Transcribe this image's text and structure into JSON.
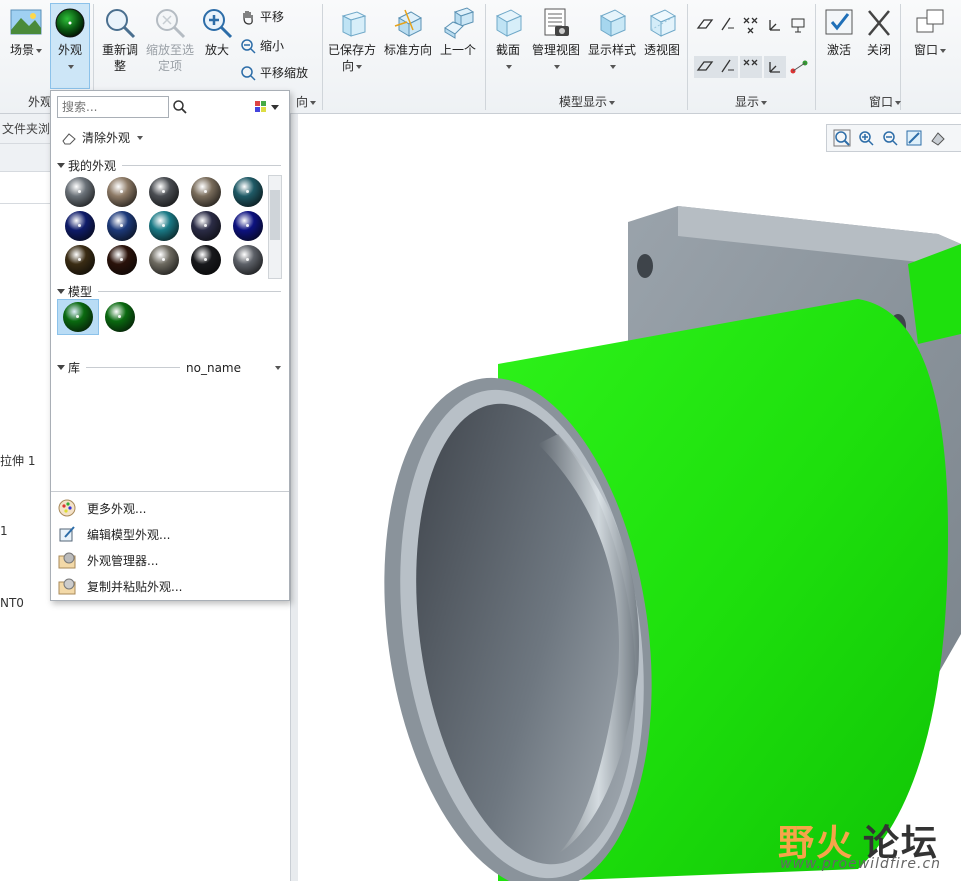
{
  "ribbon": {
    "groups": {
      "appearance": "外观",
      "orientation": "向",
      "model_display": "模型显示",
      "display": "显示",
      "window": "窗口"
    },
    "buttons": {
      "scene": "场景",
      "appearance": "外观",
      "regenerate_line1": "重新调",
      "regenerate_line2": "整",
      "zoom_to_selected_line1": "缩放至选",
      "zoom_to_selected_line2": "定项",
      "zoom_in": "放大",
      "pan": "平移",
      "zoom_out": "缩小",
      "pan_zoom": "平移缩放",
      "saved_orient_line1": "已保存方",
      "saved_orient_line2": "向",
      "standard_orient": "标准方向",
      "previous": "上一个",
      "section": "截面",
      "manage_views": "管理视图",
      "display_style": "显示样式",
      "perspective": "透视图",
      "activate": "激活",
      "close": "关闭",
      "window": "窗口"
    }
  },
  "left_panel": {
    "header": "文件夹浏览",
    "tree_items": [
      "拉伸 1",
      "1",
      "NT0"
    ]
  },
  "appearance_panel": {
    "search_placeholder": "搜索...",
    "clear_label": "清除外观",
    "my_appearances_title": "我的外观",
    "model_title": "模型",
    "library_title": "库",
    "library_value": "no_name",
    "swatch_colors": [
      "#6a7178",
      "#8d7a66",
      "#4a4d52",
      "#7a6d5c",
      "#1f5a66",
      "#0f1c6a",
      "#1d3a7a",
      "#1a7a86",
      "#2b2c46",
      "#0d1280",
      "#3a2c14",
      "#2a120a",
      "#6d6a60",
      "#18191c",
      "#5d6168"
    ],
    "model_swatches": [
      "#0a6a10",
      "#0a6a10"
    ],
    "menu": [
      "更多外观...",
      "编辑模型外观...",
      "外观管理器...",
      "复制并粘贴外观..."
    ]
  },
  "viewport": {
    "model_color": "#22ee11",
    "watermark_cn_a": "野火",
    "watermark_cn_b": "论坛",
    "watermark_url": "www.proewildfire.cn"
  }
}
